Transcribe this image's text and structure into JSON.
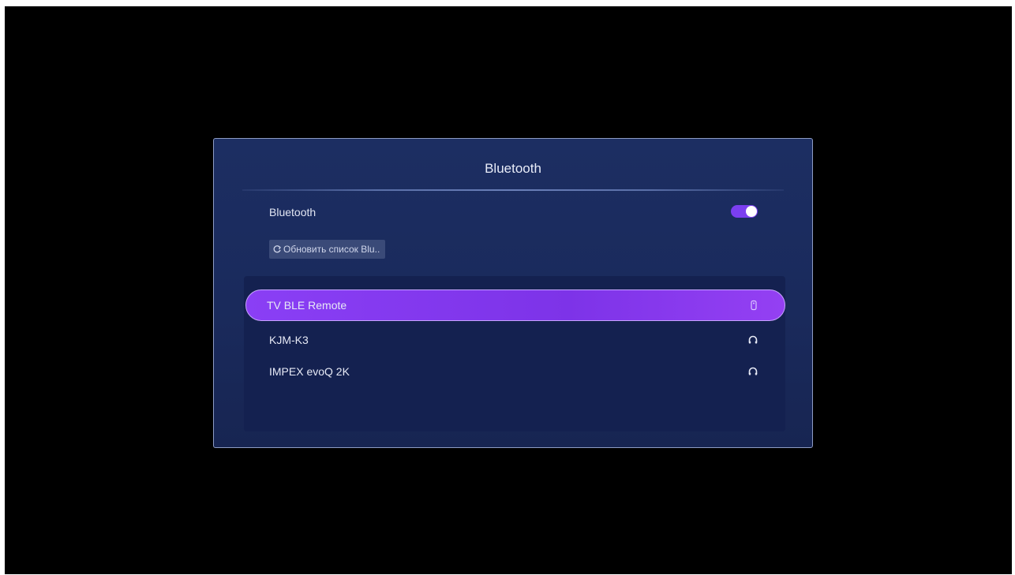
{
  "dialog": {
    "title": "Bluetooth"
  },
  "bluetooth_toggle": {
    "label": "Bluetooth",
    "enabled": true,
    "accent_color": "#7b3ff0"
  },
  "refresh_button": {
    "label": "Обновить список Blu..",
    "icon": "refresh-icon"
  },
  "devices": [
    {
      "name": "TV BLE Remote",
      "icon": "remote-icon",
      "selected": true
    },
    {
      "name": "KJM-K3",
      "icon": "headphones-icon",
      "selected": false
    },
    {
      "name": "IMPEX evoQ 2K",
      "icon": "headphones-icon",
      "selected": false
    }
  ],
  "colors": {
    "dialog_bg": "#1c2e62",
    "selection": "#8a3ff5",
    "screen_bg": "#000000"
  }
}
